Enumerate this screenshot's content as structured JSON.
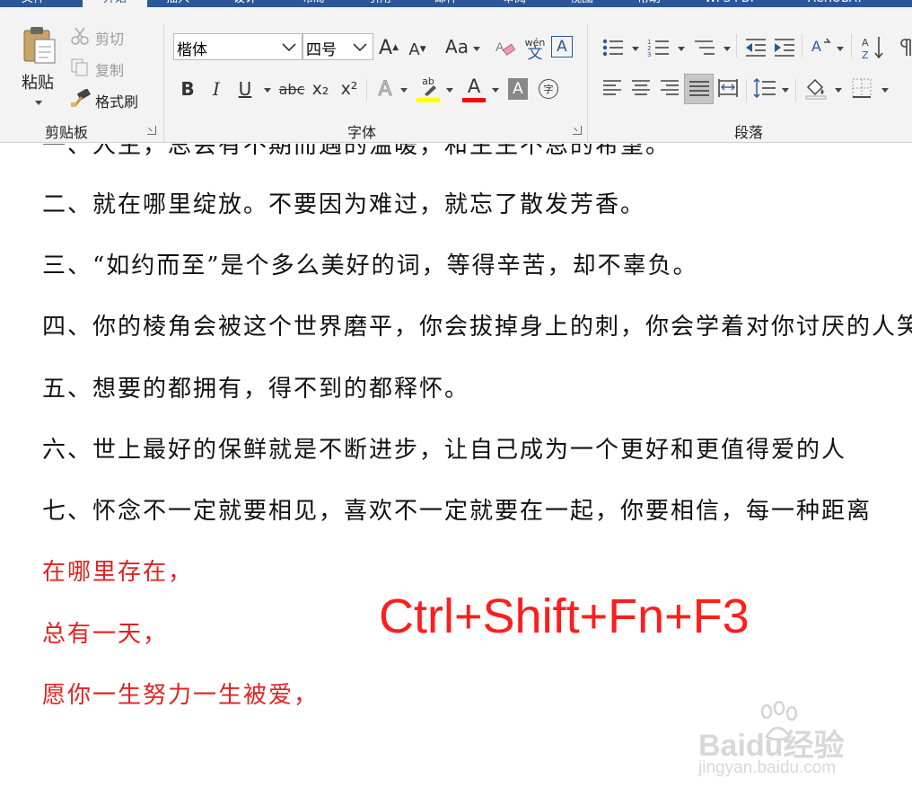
{
  "tabs": [
    "文件",
    "开始",
    "插入",
    "设计",
    "布局",
    "引用",
    "邮件",
    "审阅",
    "视图",
    "帮助",
    "WPS PDF",
    "ACROBAT"
  ],
  "clipboard": {
    "paste": "粘贴",
    "cut": "剪切",
    "copy": "复制",
    "format_painter": "格式刷",
    "group_label": "剪贴板"
  },
  "font": {
    "font_name": "楷体",
    "font_size": "四号",
    "group_label": "字体",
    "bold": "B",
    "italic": "I",
    "underline": "U",
    "strikethrough": "abc",
    "subscript": "x₂",
    "superscript": "x²",
    "change_case": "Aa",
    "phonetic_top": "wén",
    "phonetic_bottom": "文",
    "char_border": "A",
    "text_effects": "A",
    "font_color": "A",
    "char_shading": "A",
    "enclose_char": "字",
    "highlight_label": "ab",
    "grow": "A",
    "shrink": "A"
  },
  "paragraph": {
    "group_label": "段落"
  },
  "colors": {
    "accent": "#2b579a",
    "highlight": "#ffff00",
    "font_color": "#ff0000",
    "text_red": "#e42020"
  },
  "document": {
    "partial_line": "一、人生，总会有不期而遇的温暖，和生生不息的希望。",
    "lines": [
      "二、就在哪里绽放。不要因为难过，就忘了散发芳香。",
      "三、“如约而至”是个多么美好的词，等得辛苦，却不辜负。",
      "四、你的棱角会被这个世界磨平，你会拔掉身上的刺，你会学着对你讨厌的人笑",
      "五、想要的都拥有，得不到的都释怀。",
      "六、世上最好的保鲜就是不断进步，让自己成为一个更好和更值得爱的人",
      "七、怀念不一定就要相见，喜欢不一定就要在一起，你要相信，每一种距离"
    ],
    "red_lines": [
      "在哪里存在，",
      "总有一天，",
      "愿你一生努力一生被爱，"
    ]
  },
  "overlay": {
    "shortcut": "Ctrl+Shift+Fn+F3"
  },
  "watermark": {
    "brand": "Baidu经验",
    "url": "jingyan.baidu.com"
  }
}
